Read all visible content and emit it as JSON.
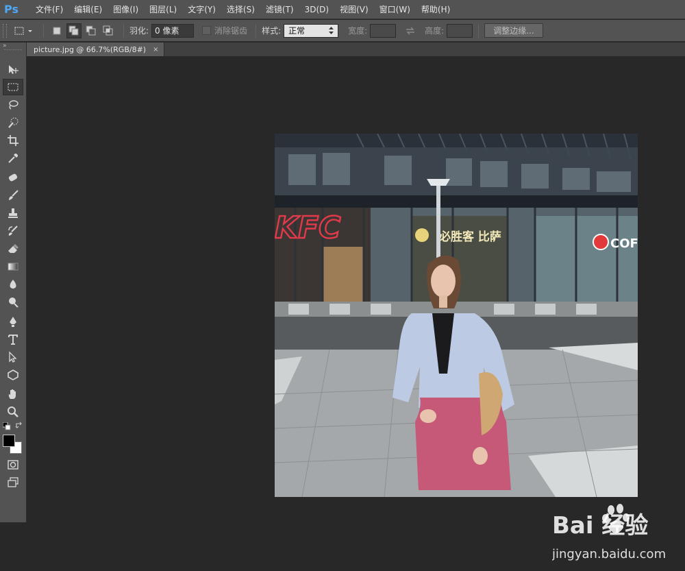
{
  "app": {
    "logo": "Ps",
    "accent_color": "#4fa8f5"
  },
  "menubar": {
    "items": [
      {
        "label": "文件(F)"
      },
      {
        "label": "编辑(E)"
      },
      {
        "label": "图像(I)"
      },
      {
        "label": "图层(L)"
      },
      {
        "label": "文字(Y)"
      },
      {
        "label": "选择(S)"
      },
      {
        "label": "滤镜(T)"
      },
      {
        "label": "3D(D)"
      },
      {
        "label": "视图(V)"
      },
      {
        "label": "窗口(W)"
      },
      {
        "label": "帮助(H)"
      }
    ]
  },
  "options": {
    "feather_label": "羽化:",
    "feather_value": "0 像素",
    "antialias_label": "消除锯齿",
    "style_label": "样式:",
    "style_value": "正常",
    "width_label": "宽度:",
    "height_label": "高度:",
    "refine_edge_label": "调整边缘..."
  },
  "document": {
    "tab_title": "picture.jpg @ 66.7%(RGB/8#)",
    "close_glyph": "×"
  },
  "toolbar": {
    "collapse_glyph": "»",
    "tools": [
      {
        "name": "move-tool-icon"
      },
      {
        "name": "rectangular-marquee-tool-icon"
      },
      {
        "name": "lasso-tool-icon"
      },
      {
        "name": "quick-selection-tool-icon"
      },
      {
        "name": "crop-tool-icon"
      },
      {
        "name": "eyedropper-tool-icon"
      },
      {
        "name": "spot-healing-brush-icon"
      },
      {
        "name": "brush-tool-icon"
      },
      {
        "name": "clone-stamp-tool-icon"
      },
      {
        "name": "history-brush-icon"
      },
      {
        "name": "eraser-tool-icon"
      },
      {
        "name": "gradient-tool-icon"
      },
      {
        "name": "blur-tool-icon"
      },
      {
        "name": "dodge-tool-icon"
      },
      {
        "name": "pen-tool-icon"
      },
      {
        "name": "type-tool-icon"
      },
      {
        "name": "path-selection-tool-icon"
      },
      {
        "name": "shape-tool-icon"
      },
      {
        "name": "hand-tool-icon"
      },
      {
        "name": "zoom-tool-icon"
      }
    ],
    "foreground_color": "#000000",
    "background_color": "#ffffff"
  },
  "photo": {
    "sign_kfc": "KFC",
    "sign_shop": "必胜客 比萨",
    "sign_coffee": "COFFEE"
  },
  "watermark": {
    "brand": "Bai  经验",
    "url": "jingyan.baidu.com"
  }
}
